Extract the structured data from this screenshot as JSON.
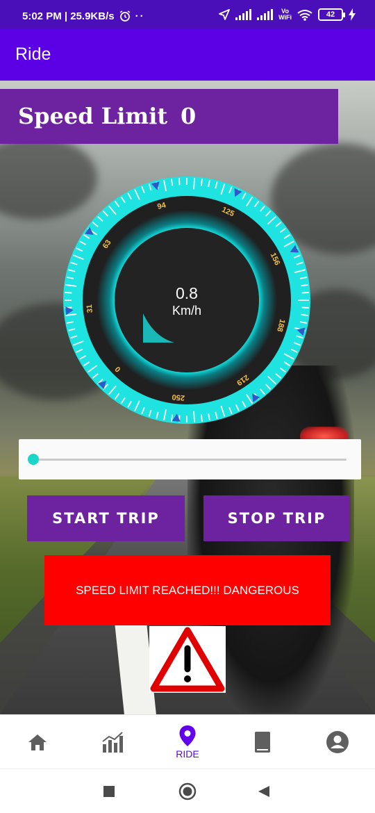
{
  "status_bar": {
    "time_speed": "5:02 PM | 25.9KB/s",
    "volte_top": "Vo",
    "volte_bottom": "WiFi",
    "battery": "42",
    "icons": [
      "alarm-icon",
      "more-dots-icon",
      "location-arrow-icon",
      "signal-icon",
      "signal-icon",
      "wifi-icon",
      "battery-icon",
      "charging-icon"
    ]
  },
  "app_bar": {
    "title": "Ride"
  },
  "speed_limit": {
    "label": "Speed Limit",
    "value": "0"
  },
  "gauge": {
    "value": "0.8",
    "unit": "Km/h",
    "ticks": [
      "0",
      "31",
      "63",
      "94",
      "125",
      "156",
      "188",
      "219",
      "250"
    ],
    "accent_color": "#1ee3e0"
  },
  "slider": {
    "value_fraction": 0.0
  },
  "buttons": {
    "start": "START TRIP",
    "stop": "STOP TRIP"
  },
  "warning": {
    "text": "SPEED LIMIT REACHED!!! DANGEROUS",
    "color": "#ff0000"
  },
  "bottom_nav": {
    "items": [
      {
        "icon": "home-icon",
        "label": ""
      },
      {
        "icon": "stats-chart-icon",
        "label": ""
      },
      {
        "icon": "location-pin-icon",
        "label": "RIDE"
      },
      {
        "icon": "book-icon",
        "label": ""
      },
      {
        "icon": "account-icon",
        "label": ""
      }
    ],
    "active_color": "#6200ee"
  },
  "colors": {
    "status_bar": "#4a0fb8",
    "app_bar": "#5c00e6",
    "purple_panel": "#6d22a0"
  }
}
